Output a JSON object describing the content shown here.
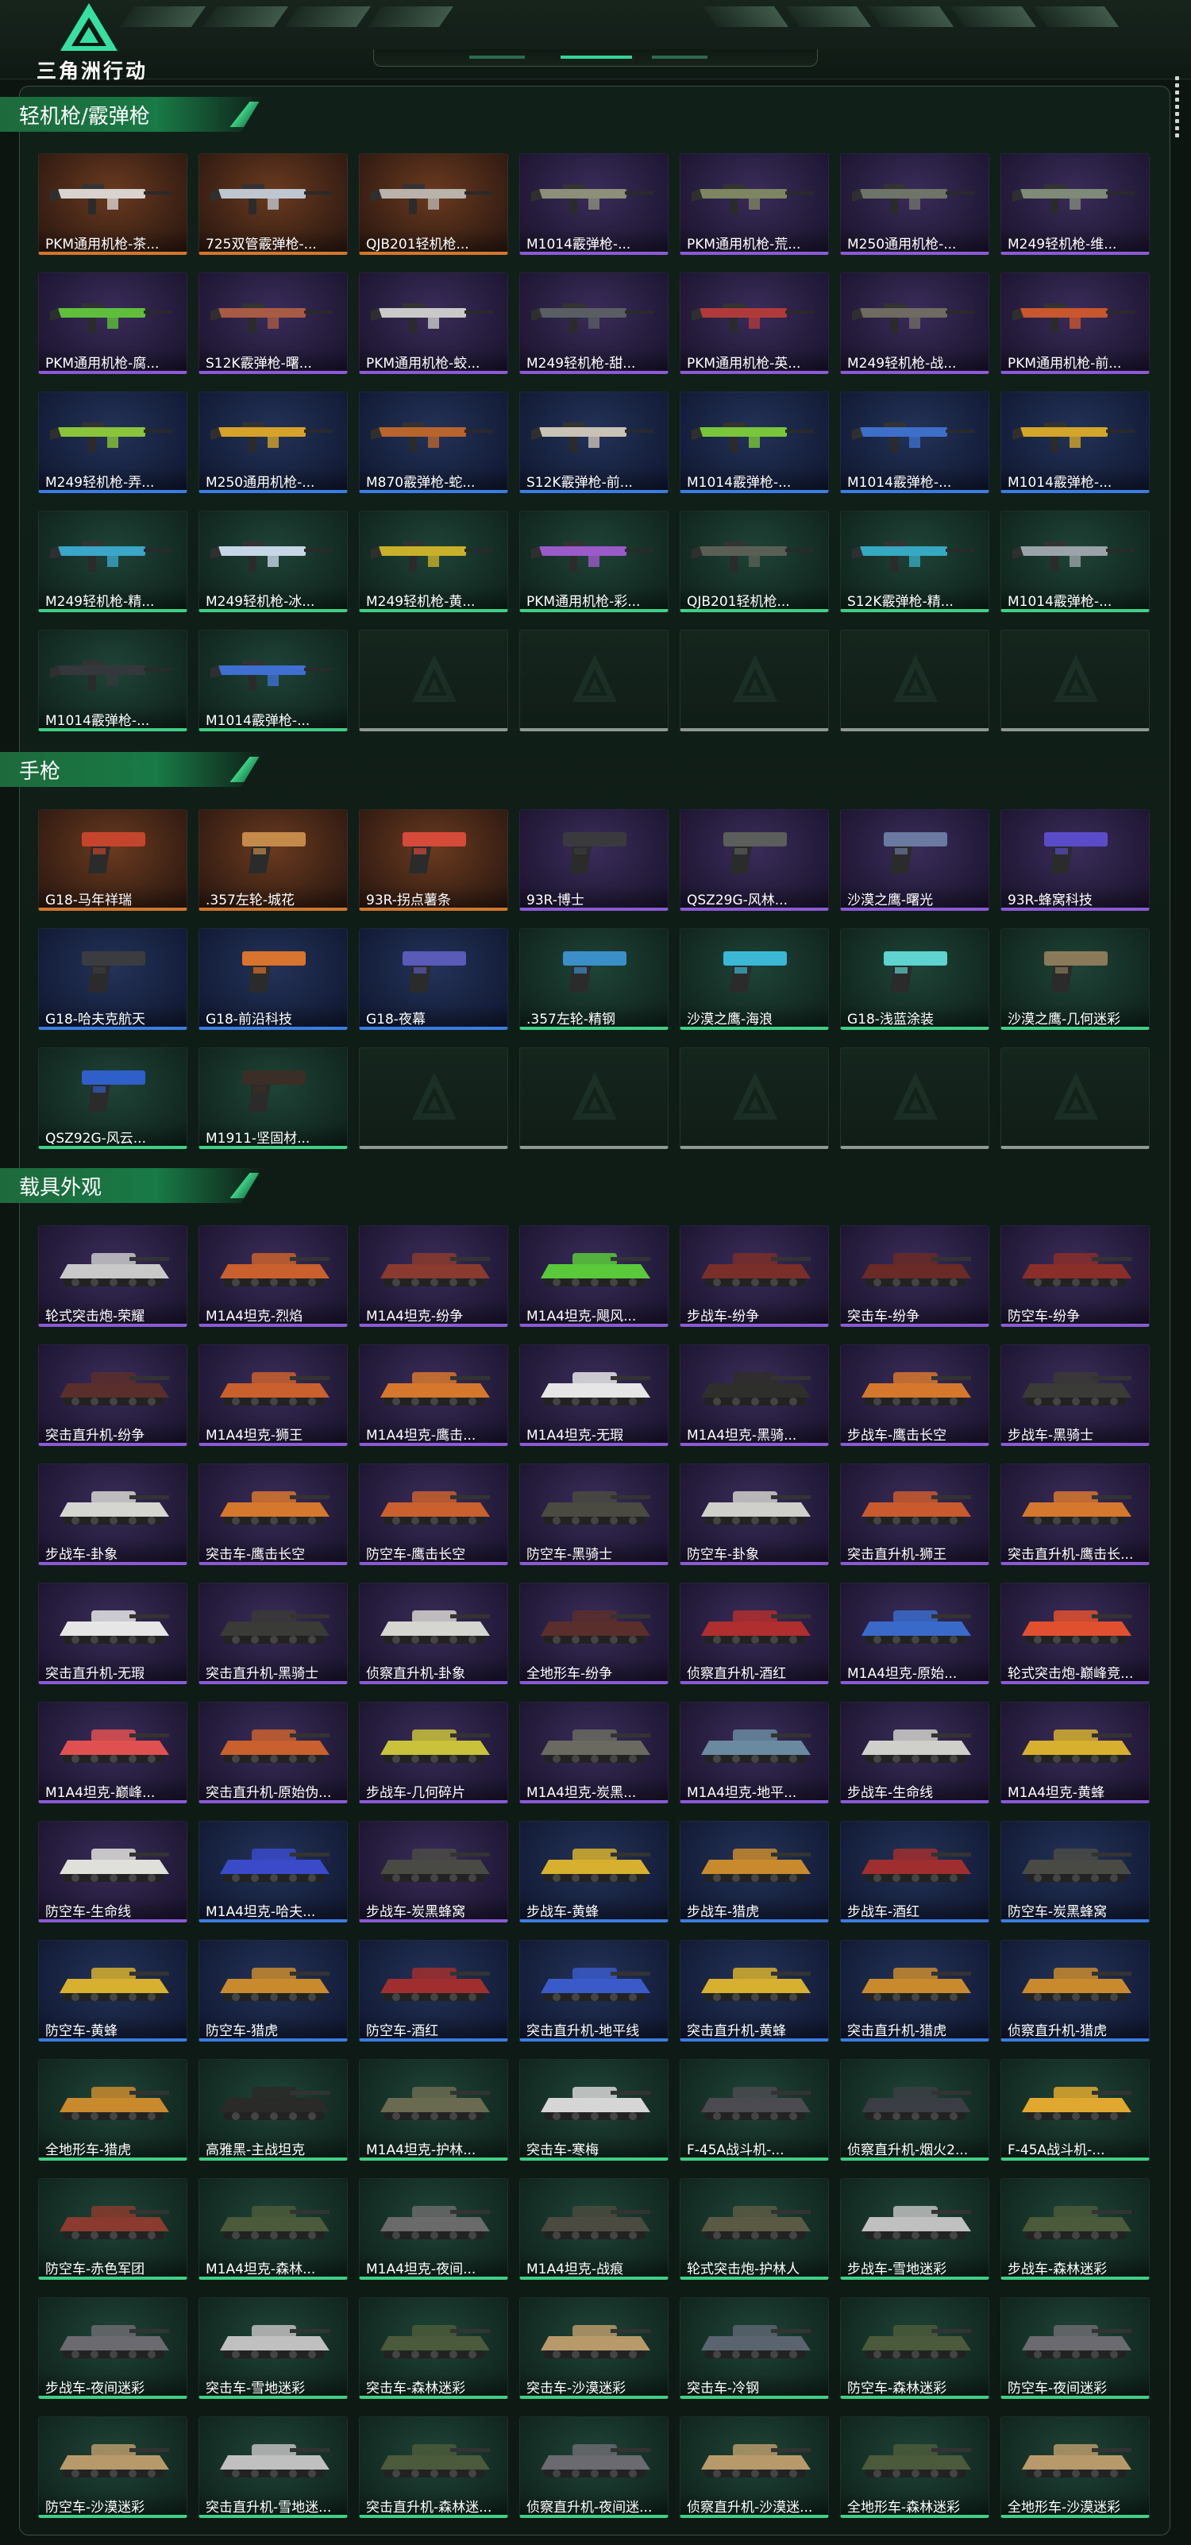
{
  "header": {
    "logo_text": "三角洲行动"
  },
  "sections": [
    {
      "title": "轻机枪/霰弹枪",
      "kind": "rifle",
      "items": [
        {
          "label": "PKM通用机枪-茶...",
          "rarity": "orange",
          "color": "#d9d3cf"
        },
        {
          "label": "725双管霰弹枪-...",
          "rarity": "orange",
          "color": "#bfc6cf"
        },
        {
          "label": "QJB201轻机枪...",
          "rarity": "orange",
          "color": "#b9b3ab"
        },
        {
          "label": "M1014霰弹枪-...",
          "rarity": "purple",
          "color": "#8d8f7a"
        },
        {
          "label": "PKM通用机枪-荒...",
          "rarity": "purple",
          "color": "#7d8562"
        },
        {
          "label": "M250通用机枪-...",
          "rarity": "purple",
          "color": "#6e7468"
        },
        {
          "label": "M249轻机枪-维...",
          "rarity": "purple",
          "color": "#7f8a78"
        },
        {
          "label": "PKM通用机枪-腐...",
          "rarity": "purple",
          "color": "#5fbf3a"
        },
        {
          "label": "S12K霰弹枪-曙...",
          "rarity": "purple",
          "color": "#a85a45"
        },
        {
          "label": "PKM通用机枪-蛟...",
          "rarity": "purple",
          "color": "#c9c9c9"
        },
        {
          "label": "M249轻机枪-甜...",
          "rarity": "purple",
          "color": "#5a5d63"
        },
        {
          "label": "PKM通用机枪-英...",
          "rarity": "purple",
          "color": "#b03a3a"
        },
        {
          "label": "M249轻机枪-战...",
          "rarity": "purple",
          "color": "#6f6a62"
        },
        {
          "label": "PKM通用机枪-前...",
          "rarity": "purple",
          "color": "#c8562e"
        },
        {
          "label": "M249轻机枪-弄...",
          "rarity": "blue",
          "color": "#8ac43a"
        },
        {
          "label": "M250通用机枪-...",
          "rarity": "blue",
          "color": "#d6a22a"
        },
        {
          "label": "M870霰弹枪-蛇...",
          "rarity": "blue",
          "color": "#b8642d"
        },
        {
          "label": "S12K霰弹枪-前...",
          "rarity": "blue",
          "color": "#c9c2b6"
        },
        {
          "label": "M1014霰弹枪-...",
          "rarity": "blue",
          "color": "#79c63a"
        },
        {
          "label": "M1014霰弹枪-...",
          "rarity": "blue",
          "color": "#3d6fc9"
        },
        {
          "label": "M1014霰弹枪-...",
          "rarity": "blue",
          "color": "#d3a52a"
        },
        {
          "label": "M249轻机枪-精...",
          "rarity": "green",
          "color": "#3aa6c9"
        },
        {
          "label": "M249轻机枪-冰...",
          "rarity": "green",
          "color": "#c7d6e6"
        },
        {
          "label": "M249轻机枪-黄...",
          "rarity": "green",
          "color": "#c9b02a"
        },
        {
          "label": "PKM通用机枪-彩...",
          "rarity": "green",
          "color": "#9a5ac9"
        },
        {
          "label": "QJB201轻机枪...",
          "rarity": "green",
          "color": "#5a5f56"
        },
        {
          "label": "S12K霰弹枪-精...",
          "rarity": "green",
          "color": "#36a9c2"
        },
        {
          "label": "M1014霰弹枪-...",
          "rarity": "green",
          "color": "#9aa3a8"
        },
        {
          "label": "M1014霰弹枪-...",
          "rarity": "green",
          "color": "#34383c"
        },
        {
          "label": "M1014霰弹枪-...",
          "rarity": "green",
          "color": "#3e6fd1"
        },
        {
          "label": "",
          "rarity": "empty"
        },
        {
          "label": "",
          "rarity": "empty"
        },
        {
          "label": "",
          "rarity": "empty"
        },
        {
          "label": "",
          "rarity": "empty"
        },
        {
          "label": "",
          "rarity": "empty"
        }
      ]
    },
    {
      "title": "手枪",
      "kind": "pistol",
      "items": [
        {
          "label": "G18-马年祥瑞",
          "rarity": "orange",
          "color": "#c5452c"
        },
        {
          "label": ".357左轮-城花",
          "rarity": "orange",
          "color": "#c48a4a"
        },
        {
          "label": "93R-拐点薯条",
          "rarity": "orange",
          "color": "#d64a3a"
        },
        {
          "label": "93R-博士",
          "rarity": "purple",
          "color": "#3a3a3e"
        },
        {
          "label": "QSZ29G-风林...",
          "rarity": "purple",
          "color": "#5b5e5a"
        },
        {
          "label": "沙漠之鹰-曙光",
          "rarity": "purple",
          "color": "#6a7aa0"
        },
        {
          "label": "93R-蜂窝科技",
          "rarity": "purple",
          "color": "#5a4cc9"
        },
        {
          "label": "G18-哈夫克航天",
          "rarity": "blue",
          "color": "#3a3c40"
        },
        {
          "label": "G18-前沿科技",
          "rarity": "blue",
          "color": "#d9742e"
        },
        {
          "label": "G18-夜幕",
          "rarity": "blue",
          "color": "#5a5ab8"
        },
        {
          "label": ".357左轮-精钢",
          "rarity": "green",
          "color": "#3a8fc9"
        },
        {
          "label": "沙漠之鹰-海浪",
          "rarity": "green",
          "color": "#3ab8d6"
        },
        {
          "label": "G18-浅蓝涂装",
          "rarity": "green",
          "color": "#5ed3cf"
        },
        {
          "label": "沙漠之鹰-几何迷彩",
          "rarity": "green",
          "color": "#8a7a5a"
        },
        {
          "label": "QSZ92G-风云...",
          "rarity": "green",
          "color": "#2f5fc9"
        },
        {
          "label": "M1911-坚固材...",
          "rarity": "green",
          "color": "#3a2e26"
        },
        {
          "label": "",
          "rarity": "empty"
        },
        {
          "label": "",
          "rarity": "empty"
        },
        {
          "label": "",
          "rarity": "empty"
        },
        {
          "label": "",
          "rarity": "empty"
        },
        {
          "label": "",
          "rarity": "empty"
        }
      ]
    },
    {
      "title": "载具外观",
      "kind": "vehicle",
      "items": [
        {
          "label": "轮式突击炮-荣耀",
          "rarity": "purple",
          "color": "#c9c9c9"
        },
        {
          "label": "M1A4坦克-烈焰",
          "rarity": "purple",
          "color": "#c9602e"
        },
        {
          "label": "M1A4坦克-纷争",
          "rarity": "purple",
          "color": "#8a3a2e"
        },
        {
          "label": "M1A4坦克-飓风...",
          "rarity": "purple",
          "color": "#5ac93a"
        },
        {
          "label": "步战车-纷争",
          "rarity": "purple",
          "color": "#7a2e2a"
        },
        {
          "label": "突击车-纷争",
          "rarity": "purple",
          "color": "#6a2a26"
        },
        {
          "label": "防空车-纷争",
          "rarity": "purple",
          "color": "#8a2e2a"
        },
        {
          "label": "突击直升机-纷争",
          "rarity": "purple",
          "color": "#5a2e2a"
        },
        {
          "label": "M1A4坦克-狮王",
          "rarity": "purple",
          "color": "#c9602e"
        },
        {
          "label": "M1A4坦克-鹰击...",
          "rarity": "purple",
          "color": "#d6772e"
        },
        {
          "label": "M1A4坦克-无瑕",
          "rarity": "purple",
          "color": "#e6e6e6"
        },
        {
          "label": "M1A4坦克-黑骑...",
          "rarity": "purple",
          "color": "#2e2e2a"
        },
        {
          "label": "步战车-鹰击长空",
          "rarity": "purple",
          "color": "#d6772e"
        },
        {
          "label": "步战车-黑骑士",
          "rarity": "purple",
          "color": "#3a3a36"
        },
        {
          "label": "步战车-卦象",
          "rarity": "purple",
          "color": "#d6d6d0"
        },
        {
          "label": "突击车-鹰击长空",
          "rarity": "purple",
          "color": "#d6772e"
        },
        {
          "label": "防空车-鹰击长空",
          "rarity": "purple",
          "color": "#c9602e"
        },
        {
          "label": "防空车-黑骑士",
          "rarity": "purple",
          "color": "#4a4a40"
        },
        {
          "label": "防空车-卦象",
          "rarity": "purple",
          "color": "#d0d0ca"
        },
        {
          "label": "突击直升机-狮王",
          "rarity": "purple",
          "color": "#c95a2e"
        },
        {
          "label": "突击直升机-鹰击长...",
          "rarity": "purple",
          "color": "#d6772e"
        },
        {
          "label": "突击直升机-无瑕",
          "rarity": "purple",
          "color": "#e6e6e6"
        },
        {
          "label": "突击直升机-黑骑士",
          "rarity": "purple",
          "color": "#3a3a36"
        },
        {
          "label": "侦察直升机-卦象",
          "rarity": "purple",
          "color": "#d6d6d0"
        },
        {
          "label": "全地形车-纷争",
          "rarity": "purple",
          "color": "#5a2e2a"
        },
        {
          "label": "侦察直升机-酒红",
          "rarity": "purple",
          "color": "#b02e2e"
        },
        {
          "label": "M1A4坦克-原始...",
          "rarity": "purple",
          "color": "#3a6ac9"
        },
        {
          "label": "轮式突击炮-巅峰竞...",
          "rarity": "purple",
          "color": "#e0502e"
        },
        {
          "label": "M1A4坦克-巅峰...",
          "rarity": "purple",
          "color": "#e05050"
        },
        {
          "label": "突击直升机-原始伪...",
          "rarity": "purple",
          "color": "#c9602e"
        },
        {
          "label": "步战车-几何碎片",
          "rarity": "purple",
          "color": "#c9c23a"
        },
        {
          "label": "M1A4坦克-炭黑...",
          "rarity": "purple",
          "color": "#6a6a60"
        },
        {
          "label": "M1A4坦克-地平...",
          "rarity": "purple",
          "color": "#6a8aa0"
        },
        {
          "label": "步战车-生命线",
          "rarity": "purple",
          "color": "#d0d0ca"
        },
        {
          "label": "M1A4坦克-黄蜂",
          "rarity": "purple",
          "color": "#d6b02e"
        },
        {
          "label": "防空车-生命线",
          "rarity": "purple",
          "color": "#e0e0da"
        },
        {
          "label": "M1A4坦克-哈夫...",
          "rarity": "blue",
          "color": "#3a4ac9"
        },
        {
          "label": "步战车-炭黑蜂窝",
          "rarity": "purple",
          "color": "#4a4a44"
        },
        {
          "label": "步战车-黄蜂",
          "rarity": "blue",
          "color": "#d6b02e"
        },
        {
          "label": "步战车-猎虎",
          "rarity": "blue",
          "color": "#c98a2e"
        },
        {
          "label": "步战车-酒红",
          "rarity": "blue",
          "color": "#a02e2e"
        },
        {
          "label": "防空车-炭黑蜂窝",
          "rarity": "blue",
          "color": "#4a4a44"
        },
        {
          "label": "防空车-黄蜂",
          "rarity": "blue",
          "color": "#d6b02e"
        },
        {
          "label": "防空车-猎虎",
          "rarity": "blue",
          "color": "#c98a2e"
        },
        {
          "label": "防空车-酒红",
          "rarity": "blue",
          "color": "#a02e2e"
        },
        {
          "label": "突击直升机-地平线",
          "rarity": "blue",
          "color": "#3a5ac9"
        },
        {
          "label": "突击直升机-黄蜂",
          "rarity": "blue",
          "color": "#d6b02e"
        },
        {
          "label": "突击直升机-猎虎",
          "rarity": "blue",
          "color": "#c98a2e"
        },
        {
          "label": "侦察直升机-猎虎",
          "rarity": "blue",
          "color": "#c98a2e"
        },
        {
          "label": "全地形车-猎虎",
          "rarity": "green",
          "color": "#c98a2e"
        },
        {
          "label": "高雅黑-主战坦克",
          "rarity": "green",
          "color": "#2a2a28"
        },
        {
          "label": "M1A4坦克-护林...",
          "rarity": "green",
          "color": "#6a6a50"
        },
        {
          "label": "突击车-寒梅",
          "rarity": "green",
          "color": "#d6d6d6"
        },
        {
          "label": "F-45A战斗机-...",
          "rarity": "green",
          "color": "#4a4a50"
        },
        {
          "label": "侦察直升机-烟火2...",
          "rarity": "green",
          "color": "#3a3e44"
        },
        {
          "label": "F-45A战斗机-...",
          "rarity": "green",
          "color": "#e0a82e"
        },
        {
          "label": "防空车-赤色军团",
          "rarity": "green",
          "color": "#8a3a2e"
        },
        {
          "label": "M1A4坦克-森林...",
          "rarity": "green",
          "color": "#4a5a3a"
        },
        {
          "label": "M1A4坦克-夜间...",
          "rarity": "green",
          "color": "#6a6a6a"
        },
        {
          "label": "M1A4坦克-战痕",
          "rarity": "green",
          "color": "#4a4a40"
        },
        {
          "label": "轮式突击炮-护林人",
          "rarity": "green",
          "color": "#5a5a44"
        },
        {
          "label": "步战车-雪地迷彩",
          "rarity": "green",
          "color": "#c0c0c0"
        },
        {
          "label": "步战车-森林迷彩",
          "rarity": "green",
          "color": "#4a5a3a"
        },
        {
          "label": "步战车-夜间迷彩",
          "rarity": "green",
          "color": "#6a6a70"
        },
        {
          "label": "突击车-雪地迷彩",
          "rarity": "green",
          "color": "#c0c0c0"
        },
        {
          "label": "突击车-森林迷彩",
          "rarity": "green",
          "color": "#4a5a3a"
        },
        {
          "label": "突击车-沙漠迷彩",
          "rarity": "green",
          "color": "#b89a6a"
        },
        {
          "label": "突击车-冷钢",
          "rarity": "green",
          "color": "#5a6470"
        },
        {
          "label": "防空车-森林迷彩",
          "rarity": "green",
          "color": "#4a5a3a"
        },
        {
          "label": "防空车-夜间迷彩",
          "rarity": "green",
          "color": "#6a6a70"
        },
        {
          "label": "防空车-沙漠迷彩",
          "rarity": "green",
          "color": "#b89a6a"
        },
        {
          "label": "突击直升机-雪地迷...",
          "rarity": "green",
          "color": "#c0c0c0"
        },
        {
          "label": "突击直升机-森林迷...",
          "rarity": "green",
          "color": "#4a5a3a"
        },
        {
          "label": "侦察直升机-夜间迷...",
          "rarity": "green",
          "color": "#6a6a70"
        },
        {
          "label": "侦察直升机-沙漠迷...",
          "rarity": "green",
          "color": "#b89a6a"
        },
        {
          "label": "全地形车-森林迷彩",
          "rarity": "green",
          "color": "#4a5a3a"
        },
        {
          "label": "全地形车-沙漠迷彩",
          "rarity": "green",
          "color": "#b89a6a"
        }
      ]
    }
  ]
}
